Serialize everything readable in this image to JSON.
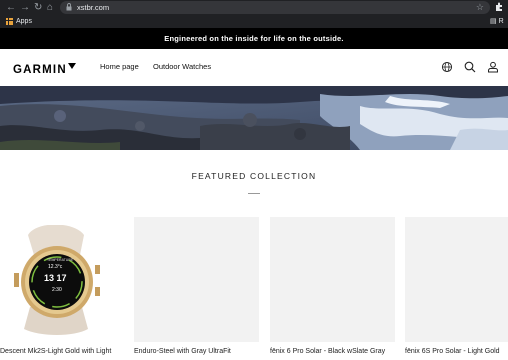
{
  "browser": {
    "url": "xstbr.com",
    "bookmarks_apps": "Apps",
    "reading_list_fragment": "R"
  },
  "announcement": "Engineered on the inside for life on the outside.",
  "header": {
    "logo": "GARMIN",
    "nav": [
      "Home page",
      "Outdoor Watches"
    ]
  },
  "featured": {
    "title": "FEATURED COLLECTION",
    "products": [
      {
        "title": "Descent Mk2S-Light Gold with Light"
      },
      {
        "title": "Enduro-Steel with Gray UltraFit"
      },
      {
        "title": "fēnix 6 Pro Solar - Black wSlate Gray"
      },
      {
        "title": "fēnix 6S Pro Solar - Light Gold"
      }
    ],
    "watch_screen": {
      "top": "TEMPERATURE",
      "temp": "12.3°c",
      "time": "13 17",
      "bottom": "2:30"
    }
  }
}
